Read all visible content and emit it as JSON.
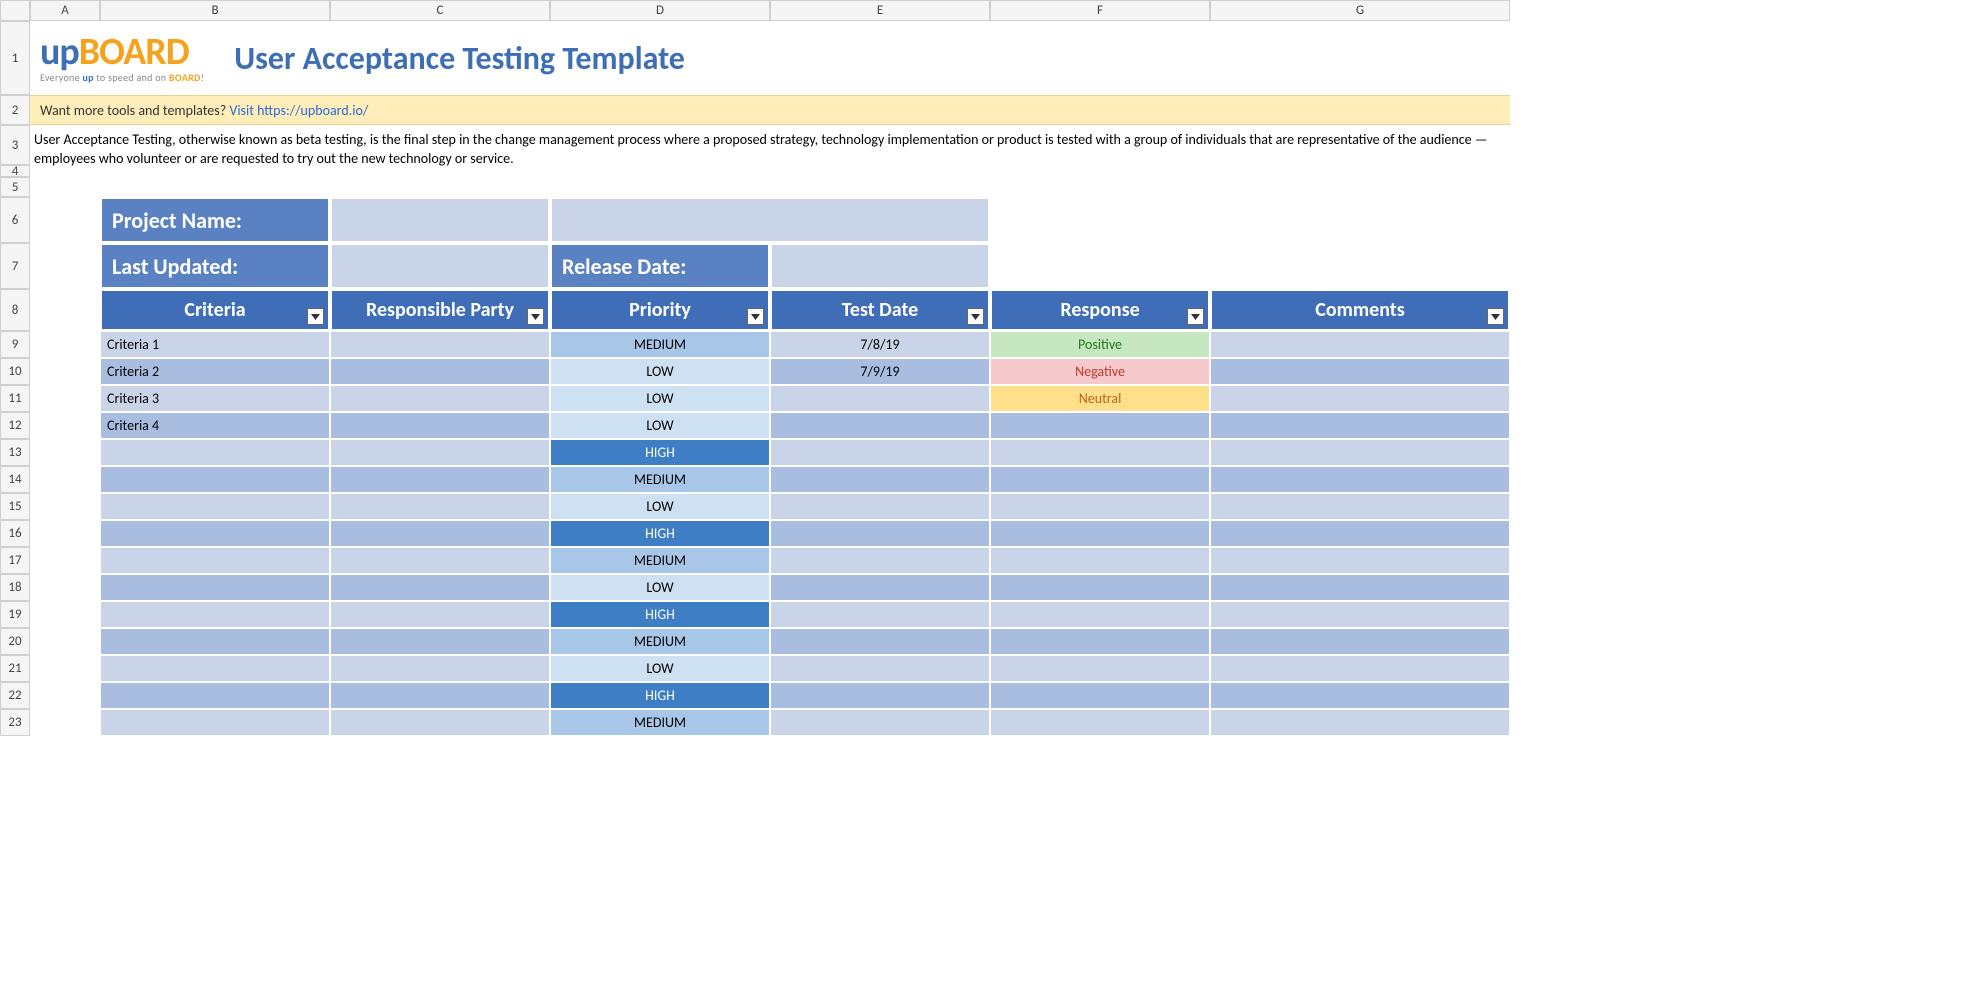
{
  "columns": [
    "A",
    "B",
    "C",
    "D",
    "E",
    "F",
    "G"
  ],
  "logo": {
    "up": "up",
    "board": "BOARD",
    "tagline_pre": "Everyone ",
    "tagline_up": "up",
    "tagline_mid": " to speed and on ",
    "tagline_board": "BOARD",
    "tagline_post": "!"
  },
  "title": "User Acceptance Testing Template",
  "banner": {
    "prefix": "Want more tools and templates? ",
    "link_text": "Visit https://upboard.io/"
  },
  "description": "User Acceptance Testing, otherwise known as beta testing, is the final step in the change management process where a proposed strategy, technology implementation or product is tested with a group of individuals that are representative of the audience — employees who volunteer or are requested to try out the new technology or service.",
  "meta": {
    "project_name_label": "Project Name:",
    "project_name_value": "",
    "last_updated_label": "Last Updated:",
    "last_updated_value": "",
    "release_date_label": "Release Date:",
    "release_date_value": ""
  },
  "table": {
    "headers": [
      "Criteria",
      "Responsible Party",
      "Priority",
      "Test Date",
      "Response",
      "Comments"
    ],
    "rows": [
      {
        "criteria": "Criteria 1",
        "party": "",
        "priority": "MEDIUM",
        "test_date": "7/8/19",
        "response": "Positive",
        "comments": ""
      },
      {
        "criteria": "Criteria 2",
        "party": "",
        "priority": "LOW",
        "test_date": "7/9/19",
        "response": "Negative",
        "comments": ""
      },
      {
        "criteria": "Criteria 3",
        "party": "",
        "priority": "LOW",
        "test_date": "",
        "response": "Neutral",
        "comments": ""
      },
      {
        "criteria": "Criteria 4",
        "party": "",
        "priority": "LOW",
        "test_date": "",
        "response": "",
        "comments": ""
      },
      {
        "criteria": "",
        "party": "",
        "priority": "HIGH",
        "test_date": "",
        "response": "",
        "comments": ""
      },
      {
        "criteria": "",
        "party": "",
        "priority": "MEDIUM",
        "test_date": "",
        "response": "",
        "comments": ""
      },
      {
        "criteria": "",
        "party": "",
        "priority": "LOW",
        "test_date": "",
        "response": "",
        "comments": ""
      },
      {
        "criteria": "",
        "party": "",
        "priority": "HIGH",
        "test_date": "",
        "response": "",
        "comments": ""
      },
      {
        "criteria": "",
        "party": "",
        "priority": "MEDIUM",
        "test_date": "",
        "response": "",
        "comments": ""
      },
      {
        "criteria": "",
        "party": "",
        "priority": "LOW",
        "test_date": "",
        "response": "",
        "comments": ""
      },
      {
        "criteria": "",
        "party": "",
        "priority": "HIGH",
        "test_date": "",
        "response": "",
        "comments": ""
      },
      {
        "criteria": "",
        "party": "",
        "priority": "MEDIUM",
        "test_date": "",
        "response": "",
        "comments": ""
      },
      {
        "criteria": "",
        "party": "",
        "priority": "LOW",
        "test_date": "",
        "response": "",
        "comments": ""
      },
      {
        "criteria": "",
        "party": "",
        "priority": "HIGH",
        "test_date": "",
        "response": "",
        "comments": ""
      },
      {
        "criteria": "",
        "party": "",
        "priority": "MEDIUM",
        "test_date": "",
        "response": "",
        "comments": ""
      }
    ]
  },
  "row_numbers_visible": 23
}
